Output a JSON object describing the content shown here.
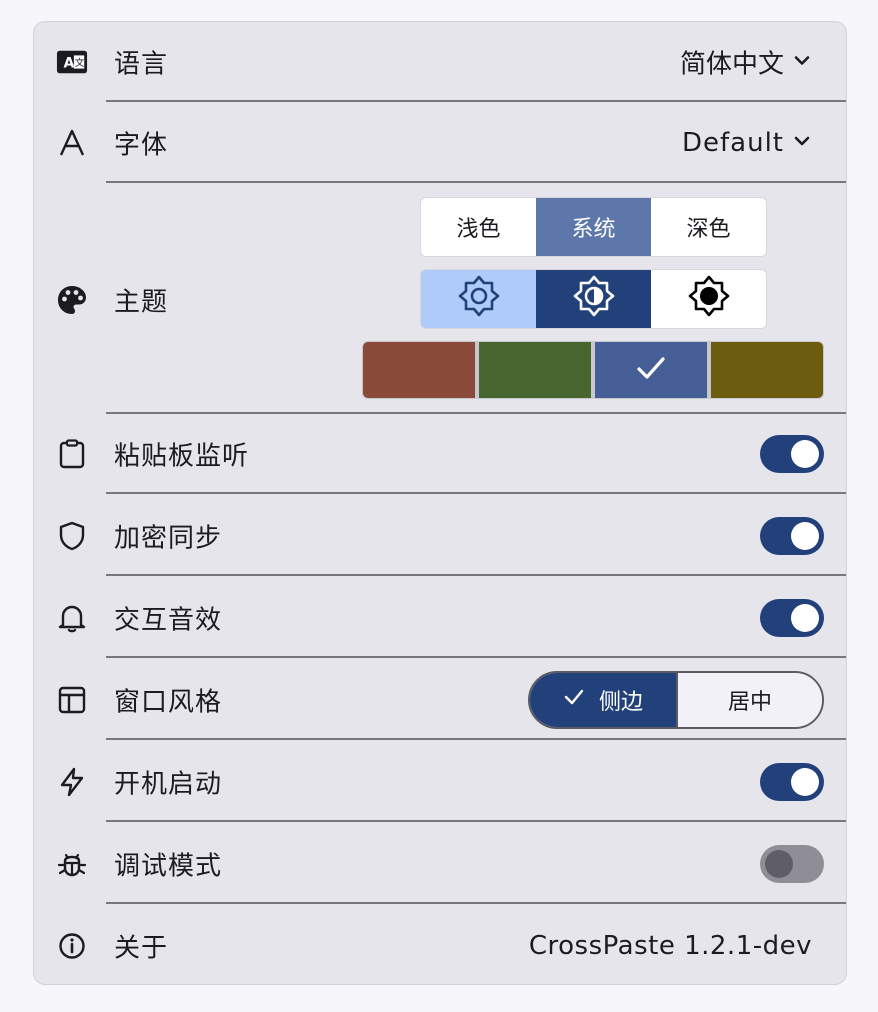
{
  "settings": {
    "language": {
      "label": "语言",
      "value": "简体中文"
    },
    "font": {
      "label": "字体",
      "value": "Default"
    },
    "theme": {
      "label": "主题",
      "modes": [
        "浅色",
        "系统",
        "深色"
      ],
      "selected_mode": "系统",
      "mode_colors": {
        "light": "#aecbfa",
        "system": "#22417a",
        "dark": "#ffffff"
      },
      "swatches": [
        {
          "color": "#8a4a3a",
          "selected": false
        },
        {
          "color": "#486630",
          "selected": false
        },
        {
          "color": "#455f96",
          "selected": true
        },
        {
          "color": "#6b5c10",
          "selected": false
        }
      ]
    },
    "clipboard_monitor": {
      "label": "粘贴板监听",
      "enabled": true
    },
    "encrypted_sync": {
      "label": "加密同步",
      "enabled": true
    },
    "sound_effects": {
      "label": "交互音效",
      "enabled": true
    },
    "window_style": {
      "label": "窗口风格",
      "options": [
        "侧边",
        "居中"
      ],
      "selected": "侧边"
    },
    "launch_at_startup": {
      "label": "开机启动",
      "enabled": true
    },
    "debug_mode": {
      "label": "调试模式",
      "enabled": false
    },
    "about": {
      "label": "关于",
      "value": "CrossPaste 1.2.1-dev"
    }
  },
  "colors": {
    "accent": "#22417a",
    "card_bg": "#e6e5ec",
    "page_bg": "#f6f6fb",
    "divider": "#77767e"
  }
}
